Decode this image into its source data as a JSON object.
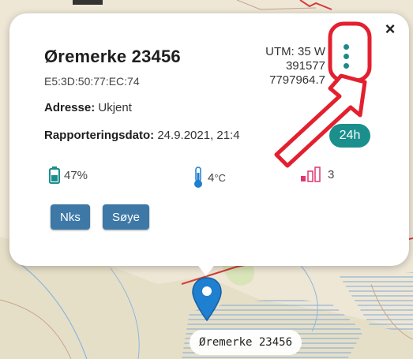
{
  "popup": {
    "close_symbol": "×",
    "title": "Øremerke 23456",
    "mac": "E5:3D:50:77:EC:74",
    "utm": {
      "zone": "UTM: 35 W",
      "easting": "391577",
      "northing": "7797964.7"
    },
    "menu_icon": "vertical-dots-icon",
    "address": {
      "label": "Adresse:",
      "value": "Ukjent"
    },
    "report_date": {
      "label": "Rapporteringsdato:",
      "value": "24.9.2021, 21:4"
    },
    "range_button": "24h",
    "stats": {
      "battery": {
        "icon": "battery-icon",
        "value": "47%",
        "fraction": 0.47
      },
      "temperature": {
        "icon": "thermometer-icon",
        "value": "4",
        "unit": "°C"
      },
      "signal": {
        "icon": "signal-bars-icon",
        "value": "3"
      }
    },
    "tag_buttons": [
      "Nks",
      "Søye"
    ]
  },
  "map": {
    "marker_label": "Øremerke 23456",
    "marker_icon": "map-pin-icon"
  },
  "colors": {
    "accent_teal": "#1a8f8c",
    "button_blue": "#3d78a6",
    "annotation_red": "#e3202f",
    "signal_pink": "#e0356e",
    "pin_blue": "#1f7fd0"
  }
}
